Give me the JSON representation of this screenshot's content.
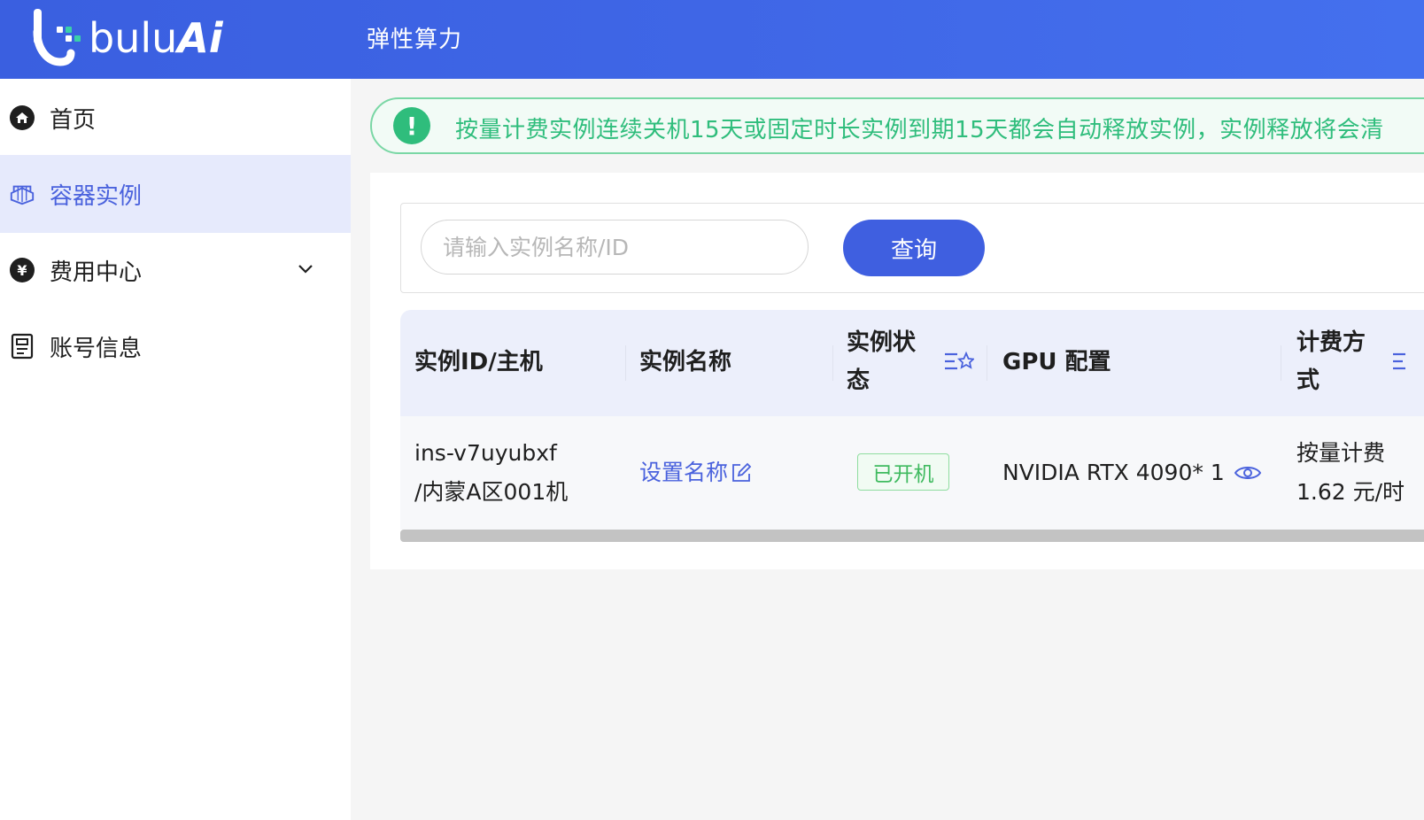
{
  "brand": {
    "logo_text_a": "bulu",
    "logo_text_b": "Ai",
    "primary_color": "#3f5fe0",
    "success_color": "#2fbd7c"
  },
  "topbar": {
    "title": "弹性算力"
  },
  "sidebar": {
    "items": [
      {
        "label": "首页",
        "icon": "home-icon"
      },
      {
        "label": "容器实例",
        "icon": "container-icon",
        "active": true
      },
      {
        "label": "费用中心",
        "icon": "yen-icon",
        "expandable": true
      },
      {
        "label": "账号信息",
        "icon": "document-icon"
      }
    ]
  },
  "alert": {
    "text": "按量计费实例连续关机15天或固定时长实例到期15天都会自动释放实例，实例释放将会清"
  },
  "search": {
    "placeholder": "请输入实例名称/ID",
    "value": "",
    "button_label": "查询"
  },
  "table": {
    "columns": {
      "id": "实例ID/主机",
      "name": "实例名称",
      "status_line1": "实例状",
      "status_line2": "态",
      "gpu": "GPU 配置",
      "billing_line1": "计费方",
      "billing_line2": "式"
    },
    "rows": [
      {
        "id_line1": "ins-v7uyubxf",
        "id_line2": "/内蒙A区001机",
        "name_link": "设置名称",
        "status": "已开机",
        "gpu": "NVIDIA RTX 4090* 1",
        "billing_line1": "按量计费",
        "billing_line2": "1.62 元/时"
      }
    ]
  }
}
